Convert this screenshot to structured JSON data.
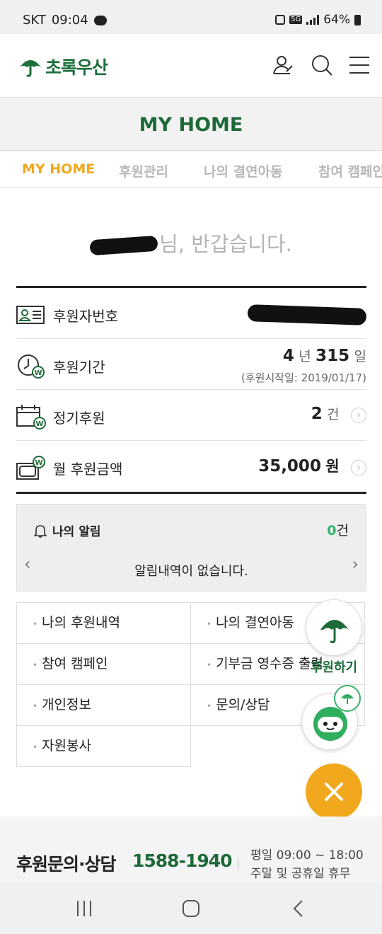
{
  "status_bar": {
    "carrier": "SKT",
    "time": "09:04",
    "network": "5G",
    "battery": "64%"
  },
  "header": {
    "logo_text": "초록우산",
    "icons": [
      "profile-icon",
      "search-icon",
      "menu-icon"
    ]
  },
  "page_title": "MY HOME",
  "tabs": [
    {
      "label": "MY HOME",
      "active": true
    },
    {
      "label": "후원관리",
      "active": false
    },
    {
      "label": "나의 결연아동",
      "active": false
    },
    {
      "label": "참여 캠페인",
      "active": false
    }
  ],
  "greeting": {
    "suffix": "님, 반갑습니다."
  },
  "info": {
    "donor_number": {
      "label": "후원자번호"
    },
    "period": {
      "label": "후원기간",
      "years": "4",
      "year_unit": "년",
      "days": "315",
      "day_unit": "일",
      "start": "(후원시작일: 2019/01/17)"
    },
    "regular": {
      "label": "정기후원",
      "count": "2",
      "unit": "건"
    },
    "monthly": {
      "label": "월 후원금액",
      "amount": "35,000",
      "unit": "원"
    }
  },
  "alerts": {
    "title": "나의 알림",
    "count": "0",
    "count_unit": "건",
    "message": "알림내역이 없습니다."
  },
  "menu": [
    "나의 후원내역",
    "나의 결연아동",
    "참여 캠페인",
    "기부금 영수증 출력",
    "개인정보",
    "문의/상담",
    "자원봉사"
  ],
  "floating": {
    "support_label": "후원하기"
  },
  "footer": {
    "label": "후원문의·상담",
    "phone": "1588-1940",
    "hours_weekday": "평일 09:00 ~ 18:00",
    "hours_weekend": "주말 및 공휴일 휴무"
  },
  "colors": {
    "brand_green": "#1d6a38",
    "accent_orange": "#f2a81d",
    "alert_green": "#2cb56d"
  }
}
